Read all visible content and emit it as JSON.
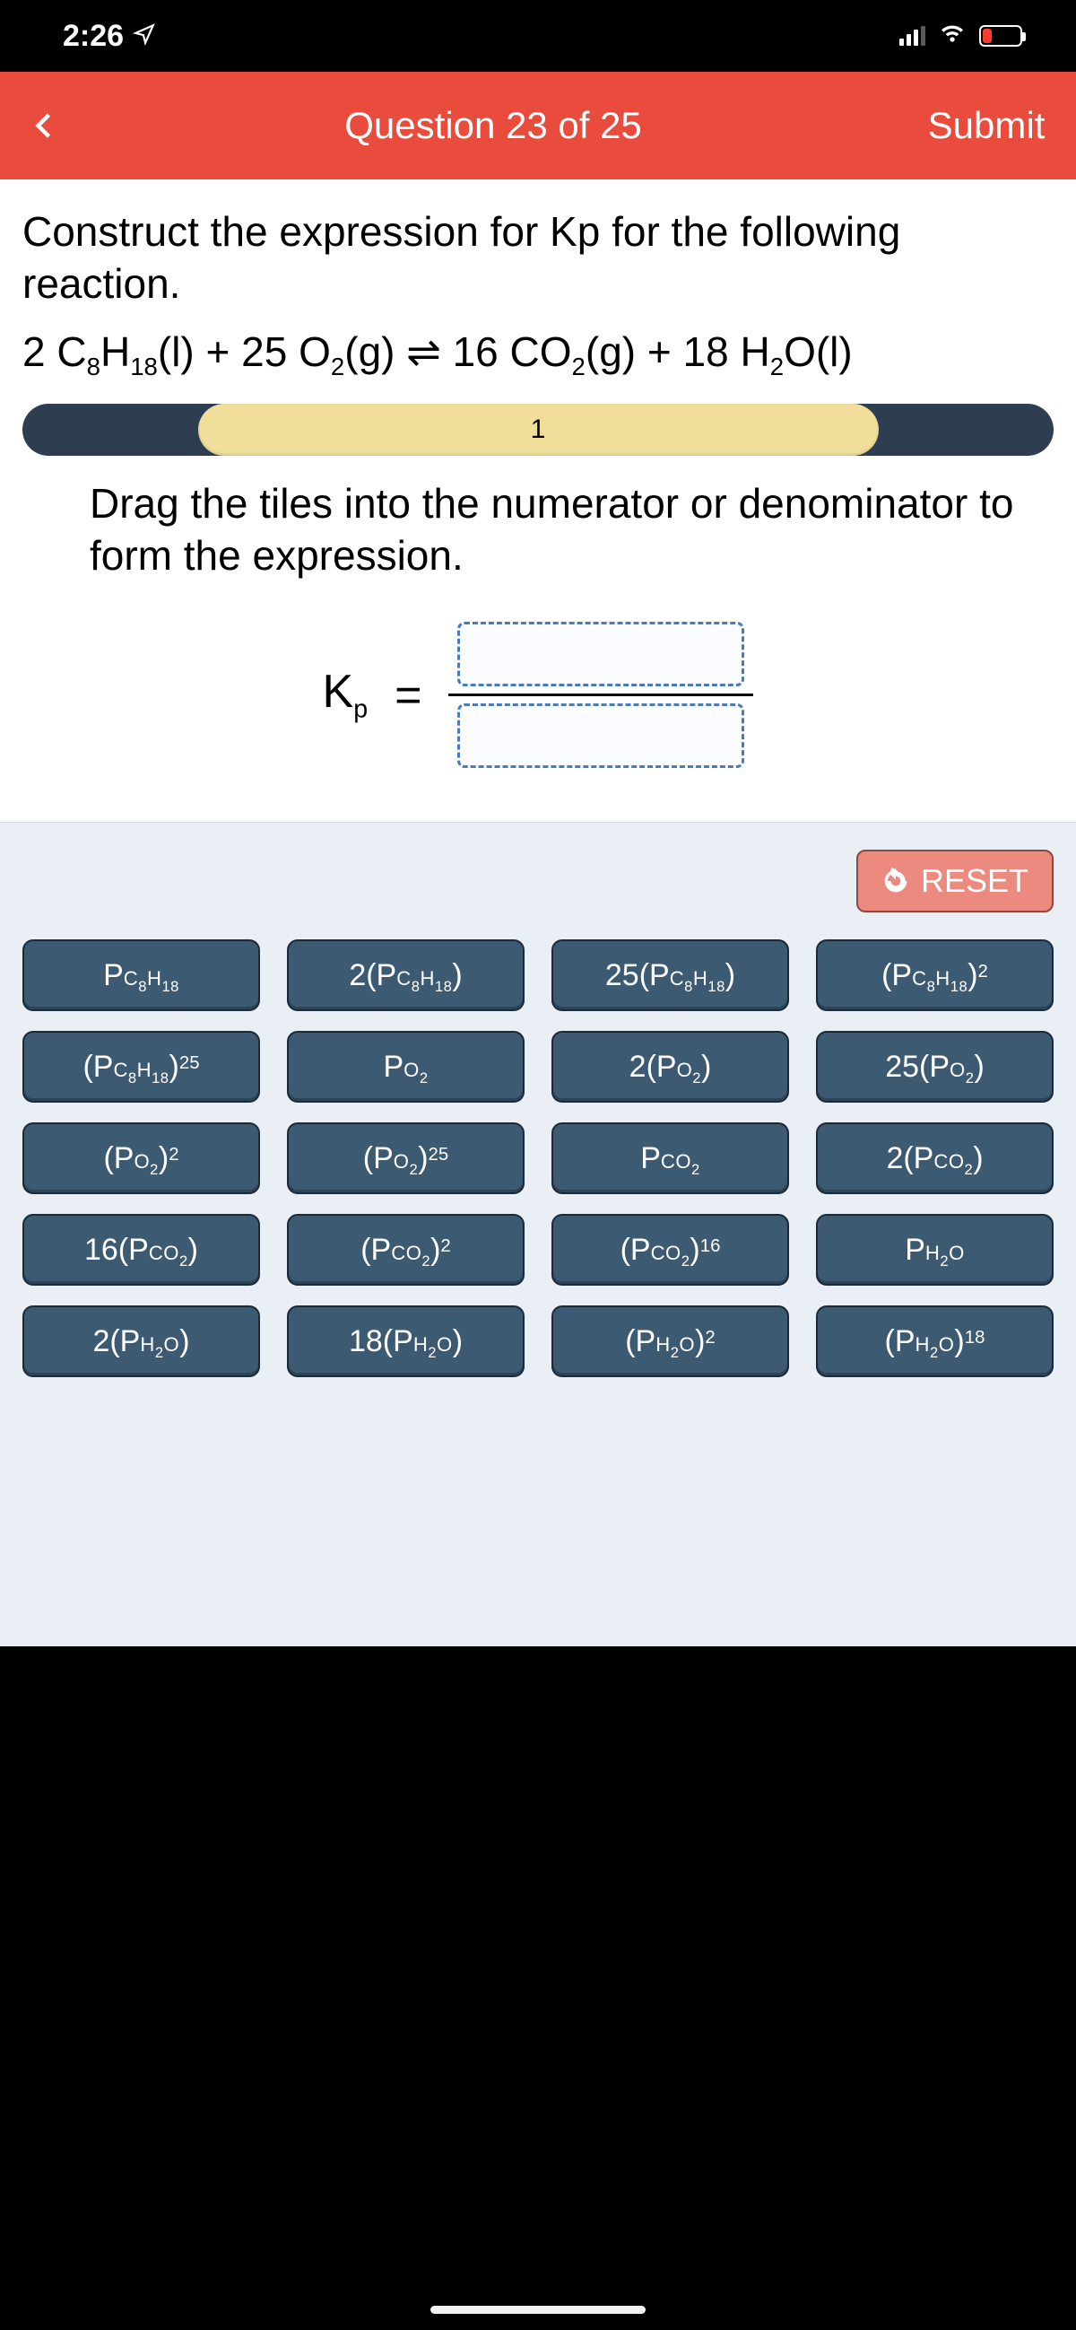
{
  "status": {
    "time": "2:26",
    "battery_level": "low"
  },
  "header": {
    "title": "Question 23 of 25",
    "submit": "Submit"
  },
  "prompt": "Construct the expression for Kp for the following reaction.",
  "equation_html": "2 C<sub>8</sub>H<sub>18</sub>(l) + 25 O<sub>2</sub>(g) ⇌ 16 CO<sub>2</sub>(g) + 18 H<sub>2</sub>O(l)",
  "progress": {
    "label": "1"
  },
  "instruction": "Drag the tiles into the numerator or denominator to form the expression.",
  "kp_label_html": "K<sub>p</sub>",
  "eq_sign": "=",
  "reset_label": "RESET",
  "tiles": [
    {
      "html": "P<span class='species'>C<sub>8</sub>H<sub>18</sub></span>"
    },
    {
      "html": "2(P<span class='species'>C<sub>8</sub>H<sub>18</sub></span>)"
    },
    {
      "html": "25(P<span class='species'>C<sub>8</sub>H<sub>18</sub></span>)"
    },
    {
      "html": "(P<span class='species'>C<sub>8</sub>H<sub>18</sub></span>)<sup>2</sup>"
    },
    {
      "html": "(P<span class='species'>C<sub>8</sub>H<sub>18</sub></span>)<sup>25</sup>"
    },
    {
      "html": "P<span class='species'>O<sub>2</sub></span>"
    },
    {
      "html": "2(P<span class='species'>O<sub>2</sub></span>)"
    },
    {
      "html": "25(P<span class='species'>O<sub>2</sub></span>)"
    },
    {
      "html": "(P<span class='species'>O<sub>2</sub></span>)<sup>2</sup>"
    },
    {
      "html": "(P<span class='species'>O<sub>2</sub></span>)<sup>25</sup>"
    },
    {
      "html": "P<span class='species'>CO<sub>2</sub></span>"
    },
    {
      "html": "2(P<span class='species'>CO<sub>2</sub></span>)"
    },
    {
      "html": "16(P<span class='species'>CO<sub>2</sub></span>)"
    },
    {
      "html": "(P<span class='species'>CO<sub>2</sub></span>)<sup>2</sup>"
    },
    {
      "html": "(P<span class='species'>CO<sub>2</sub></span>)<sup>16</sup>"
    },
    {
      "html": "P<span class='species'>H<sub>2</sub>O</span>"
    },
    {
      "html": "2(P<span class='species'>H<sub>2</sub>O</span>)"
    },
    {
      "html": "18(P<span class='species'>H<sub>2</sub>O</span>)"
    },
    {
      "html": "(P<span class='species'>H<sub>2</sub>O</span>)<sup>2</sup>"
    },
    {
      "html": "(P<span class='species'>H<sub>2</sub>O</span>)<sup>18</sup>"
    }
  ]
}
